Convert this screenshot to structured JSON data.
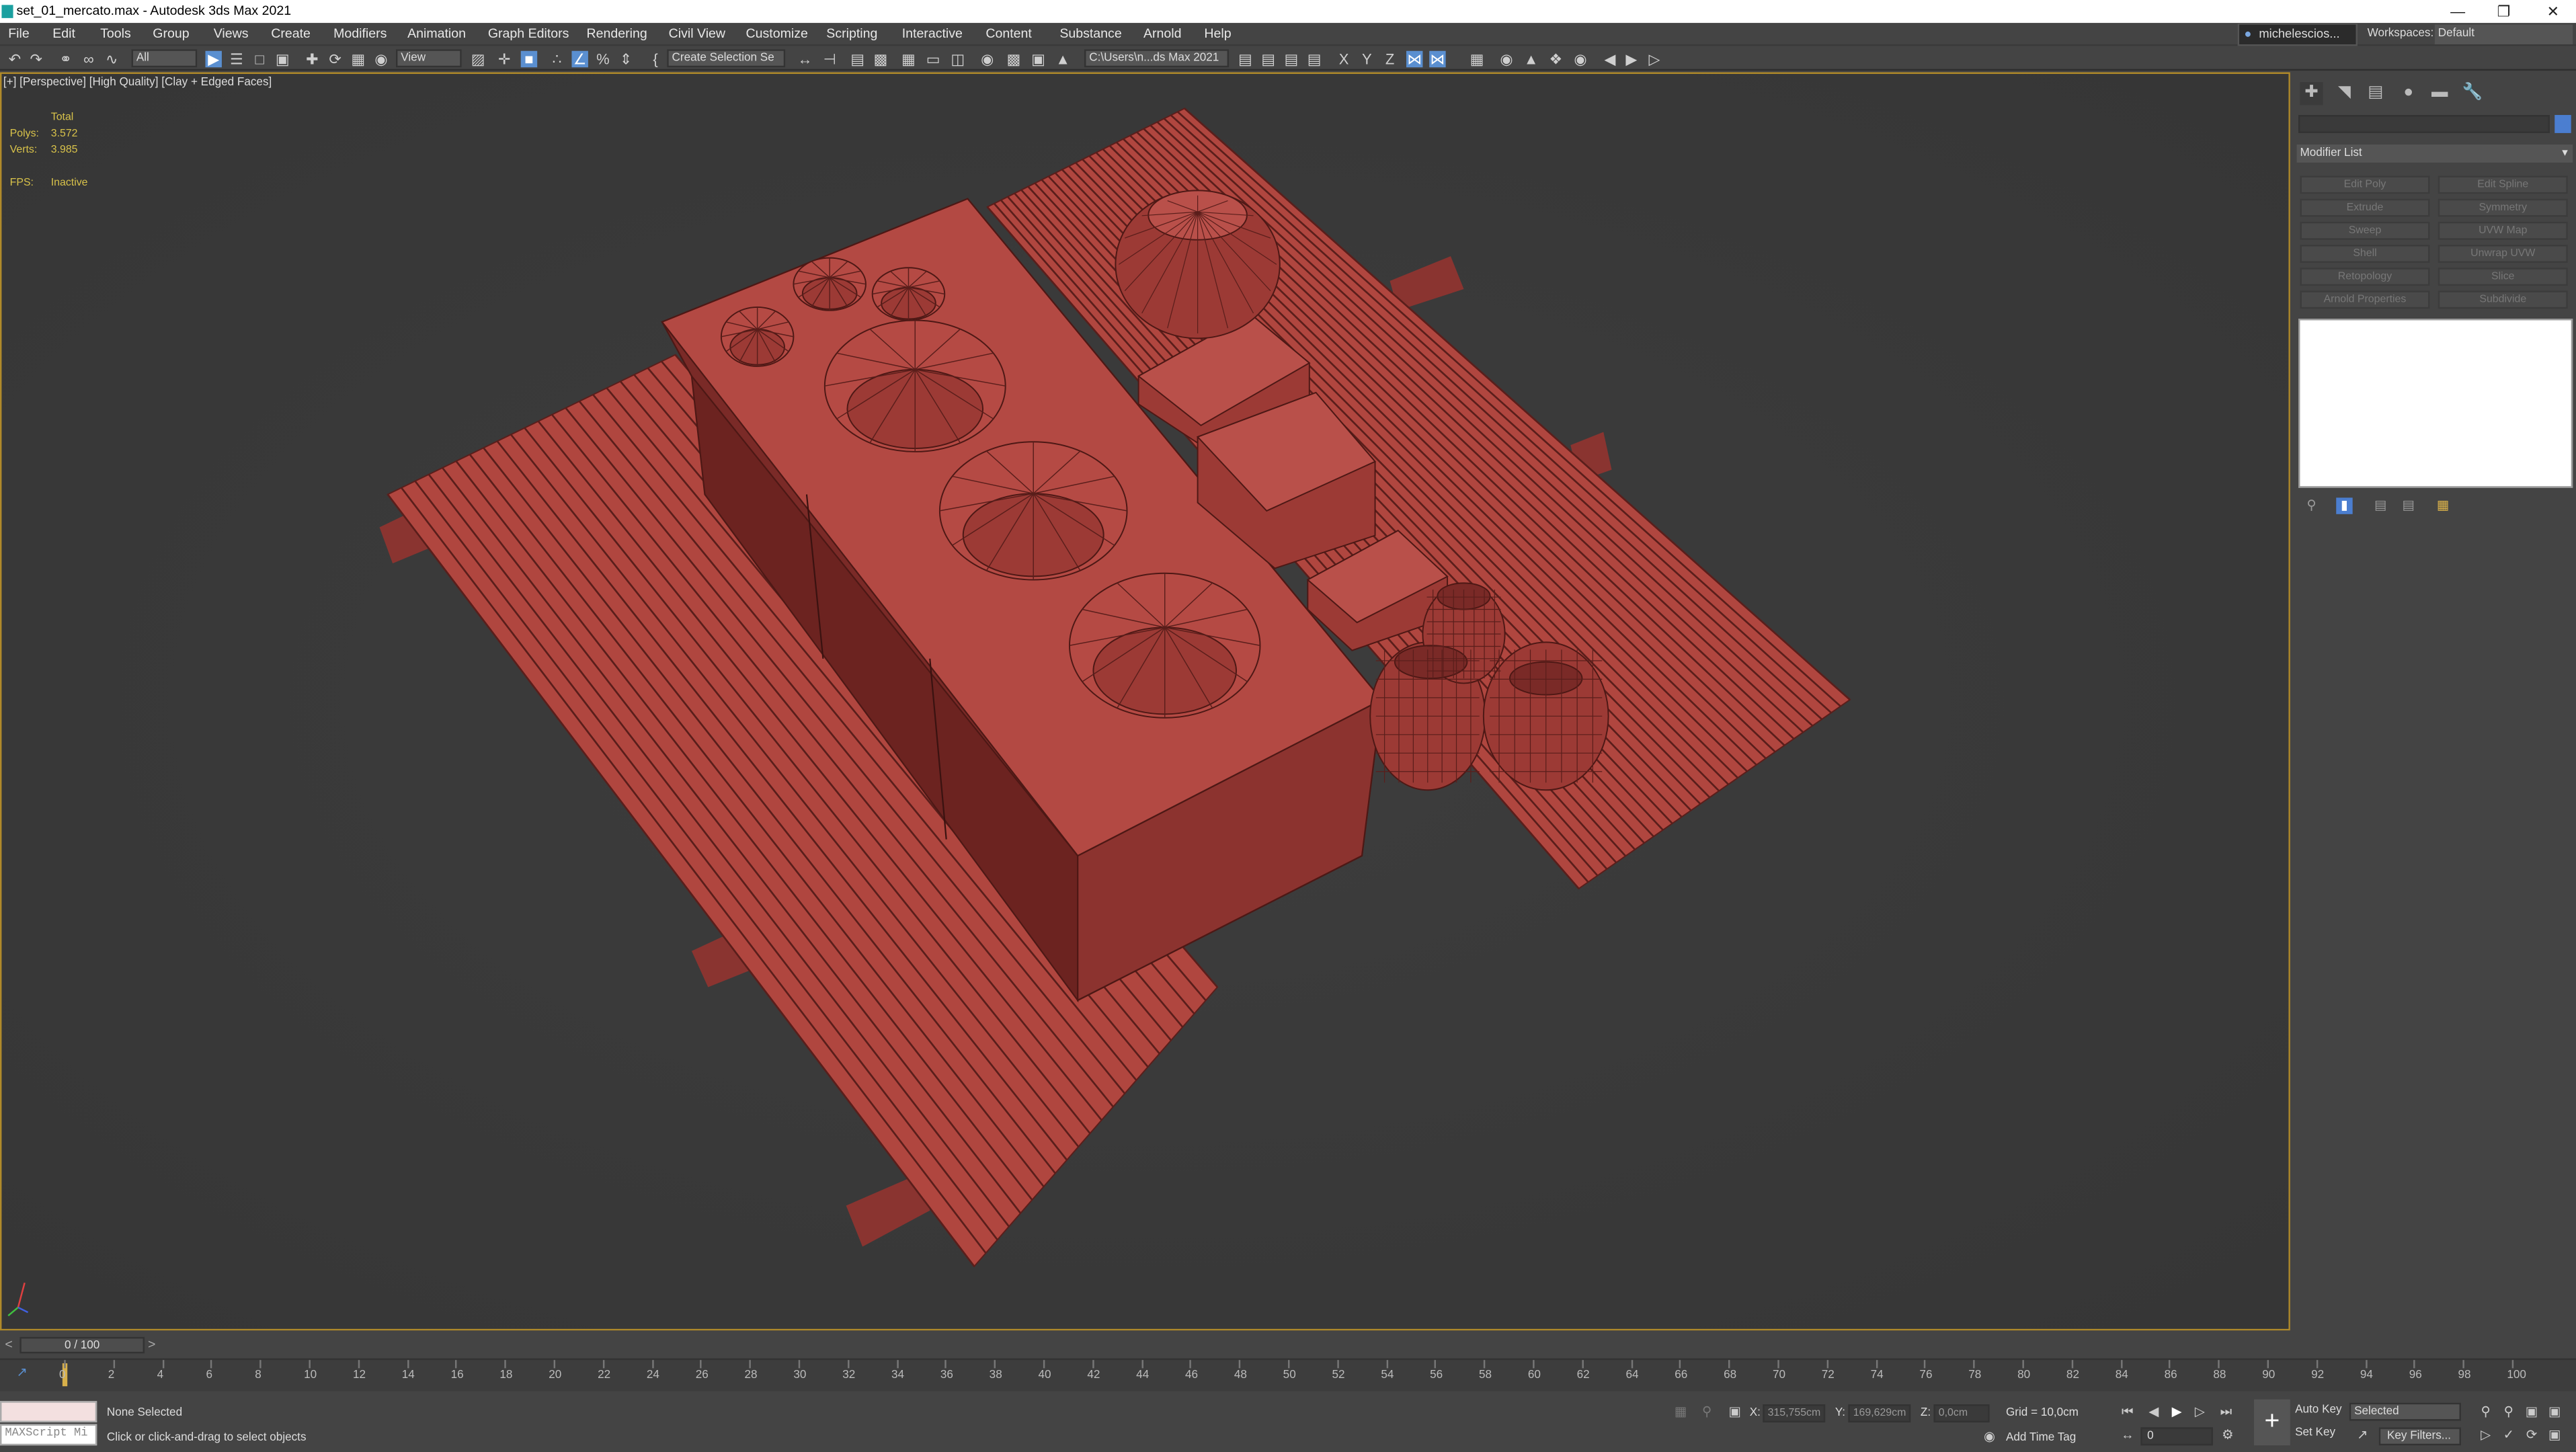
{
  "window": {
    "title": "set_01_mercato.max - Autodesk 3ds Max 2021"
  },
  "menu": [
    "File",
    "Edit",
    "Tools",
    "Group",
    "Views",
    "Create",
    "Modifiers",
    "Animation",
    "Graph Editors",
    "Rendering",
    "Civil View",
    "Customize",
    "Scripting",
    "Interactive",
    "Content",
    "Substance",
    "Arnold",
    "Help"
  ],
  "user": {
    "name": "michelescios..."
  },
  "workspace": {
    "label": "Workspaces:",
    "value": "Default"
  },
  "toolbar": {
    "filter_select": "All",
    "ref_coord_select": "View",
    "selection_set": "Create Selection Se",
    "project_path": "C:\\Users\\n...ds Max 2021",
    "axes": [
      "X",
      "Y",
      "Z"
    ]
  },
  "viewport": {
    "label": "[+] [Perspective] [High Quality] [Clay + Edged Faces]",
    "stats": {
      "total_label": "Total",
      "polys_label": "Polys:",
      "polys": "3.572",
      "verts_label": "Verts:",
      "verts": "3.985",
      "fps_label": "FPS:",
      "fps": "Inactive"
    },
    "model_color": "#b54a44"
  },
  "command_panel": {
    "modifier_list": "Modifier List",
    "modifiers": [
      "Edit Poly",
      "Edit Spline",
      "Extrude",
      "Symmetry",
      "Sweep",
      "UVW Map",
      "Shell",
      "Unwrap UVW",
      "Retopology",
      "Slice",
      "Arnold Properties",
      "Subdivide"
    ]
  },
  "time_slider": {
    "label": "0 / 100"
  },
  "trackbar": {
    "ticks": [
      "0",
      "2",
      "4",
      "6",
      "8",
      "10",
      "12",
      "14",
      "16",
      "18",
      "20",
      "22",
      "24",
      "26",
      "28",
      "30",
      "32",
      "34",
      "36",
      "38",
      "40",
      "42",
      "44",
      "46",
      "48",
      "50",
      "52",
      "54",
      "56",
      "58",
      "60",
      "62",
      "64",
      "66",
      "68",
      "70",
      "72",
      "74",
      "76",
      "78",
      "80",
      "82",
      "84",
      "86",
      "88",
      "90",
      "92",
      "94",
      "96",
      "98",
      "100"
    ]
  },
  "status": {
    "maxscript_placeholder": "MAXScript Mi",
    "selection": "None Selected",
    "prompt": "Click or click-and-drag to select objects",
    "x_label": "X:",
    "x": "315,755cm",
    "y_label": "Y:",
    "y": "169,629cm",
    "z_label": "Z:",
    "z": "0,0cm",
    "grid": "Grid = 10,0cm",
    "add_time_tag": "Add Time Tag",
    "auto_key": "Auto Key",
    "set_key": "Set Key",
    "key_mode": "Selected",
    "key_filters": "Key Filters...",
    "frame": "0"
  }
}
